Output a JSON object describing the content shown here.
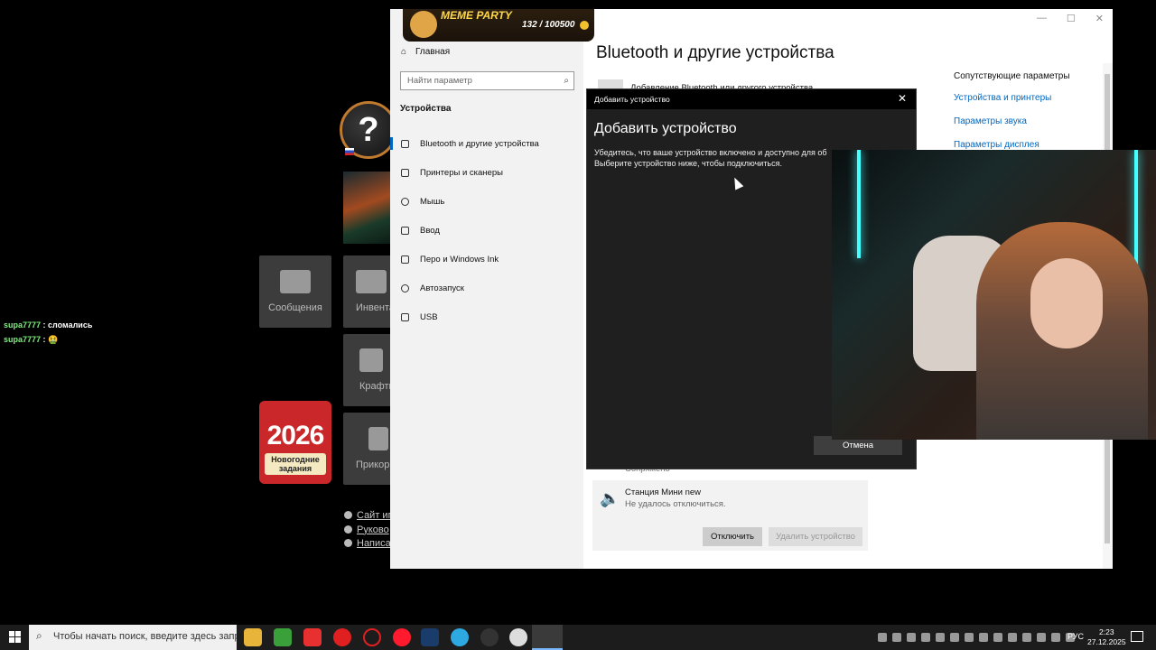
{
  "chat": [
    {
      "user": "supa7777",
      "msg": ": сломались"
    },
    {
      "user": "supa7777",
      "msg": ": 🤮"
    }
  ],
  "game": {
    "help_glyph": "?",
    "tiles": {
      "messages": "Сообщения",
      "inventory": "Инвента",
      "craft": "Крафти",
      "prikorm": "Прикорм"
    },
    "gift": {
      "year": "2026",
      "label_line1": "Новогодние",
      "label_line2": "задания"
    },
    "links": [
      "Сайт иг",
      "Руково",
      "Написат"
    ]
  },
  "meme": {
    "title": "MEME PARTY",
    "score": "132 / 100500"
  },
  "settings": {
    "home": "Главная",
    "search_placeholder": "Найти параметр",
    "section": "Устройства",
    "nav": [
      "Bluetooth и другие устройства",
      "Принтеры и сканеры",
      "Мышь",
      "Ввод",
      "Перо и Windows Ink",
      "Автозапуск",
      "USB"
    ],
    "title": "Bluetooth и другие устройства",
    "add_device": "Добавление Bluetooth или другого устройства",
    "related_heading": "Сопутствующие параметры",
    "related_links": [
      "Устройства и принтеры",
      "Параметры звука",
      "Параметры дисплея"
    ],
    "paired_status": "Сопряжено",
    "device": {
      "name": "Станция Мини new",
      "status": "Не удалось отключиться.",
      "disconnect": "Отключить",
      "remove": "Удалить устройство"
    }
  },
  "dialog": {
    "titlebar": "Добавить устройство",
    "heading": "Добавить устройство",
    "line1": "Убедитесь, что ваше устройство включено и доступно для об",
    "line2": "Выберите устройство ниже, чтобы подключиться.",
    "cancel": "Отмена"
  },
  "taskbar": {
    "search_placeholder": "Чтобы начать поиск, введите здесь запрос",
    "lang": "РУС",
    "time": "2:23",
    "date": "27.12.2025"
  },
  "colors": {
    "accent": "#0067c0",
    "neon": "#44ffff"
  }
}
